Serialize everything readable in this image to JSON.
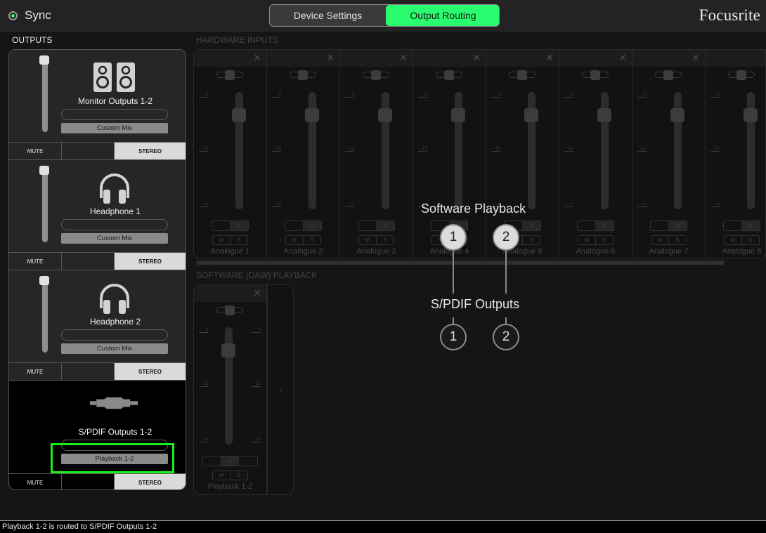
{
  "header": {
    "sync_label": "Sync",
    "sync_status_color": "#2ff06a",
    "tabs": [
      {
        "label": "Device Settings",
        "active": false
      },
      {
        "label": "Output Routing",
        "active": true
      }
    ],
    "active_tab_color": "#29fd6f",
    "brand": "Focusrite"
  },
  "outputs": {
    "section_label": "OUTPUTS",
    "cards": [
      {
        "name": "Monitor Outputs 1-2",
        "icon": "speakers-icon",
        "source": "Custom Mix",
        "mute_label": "MUTE",
        "stereo_label": "STEREO",
        "selected": false
      },
      {
        "name": "Headphone 1",
        "icon": "headphones-icon",
        "source": "Custom Mix",
        "mute_label": "MUTE",
        "stereo_label": "STEREO",
        "selected": false
      },
      {
        "name": "Headphone 2",
        "icon": "headphones-icon",
        "source": "Custom Mix",
        "mute_label": "MUTE",
        "stereo_label": "STEREO",
        "selected": false
      },
      {
        "name": "S/PDIF Outputs 1-2",
        "icon": "spdif-connector-icon",
        "source": "Playback 1-2",
        "mute_label": "MUTE",
        "stereo_label": "STEREO",
        "selected": true
      }
    ],
    "highlight_color": "#1bf01b"
  },
  "hardware_inputs": {
    "section_label": "HARDWARE INPUTS",
    "scale_labels": [
      "0",
      "-12",
      "-∞"
    ],
    "close_glyph": "✕",
    "channels": [
      {
        "name": "Analogue 1",
        "gain": "0",
        "mute": "M",
        "solo": "S"
      },
      {
        "name": "Analogue 2",
        "gain": "0",
        "mute": "M",
        "solo": "S"
      },
      {
        "name": "Analogue 3",
        "gain": "0",
        "mute": "M",
        "solo": "S"
      },
      {
        "name": "Analogue 4",
        "gain": "0",
        "mute": "M",
        "solo": "S"
      },
      {
        "name": "Analogue 5",
        "gain": "0",
        "mute": "M",
        "solo": "S"
      },
      {
        "name": "Analogue 6",
        "gain": "0",
        "mute": "M",
        "solo": "S"
      },
      {
        "name": "Analogue 7",
        "gain": "0",
        "mute": "M",
        "solo": "S"
      },
      {
        "name": "Analogue 8",
        "gain": "0",
        "mute": "M",
        "solo": "S"
      }
    ]
  },
  "software_playback": {
    "section_label": "SOFTWARE (DAW) PLAYBACK",
    "channels": [
      {
        "name": "Playback 1-2",
        "gain": "0",
        "mute": "M",
        "solo": "S"
      }
    ],
    "add_glyph": "+"
  },
  "routing_overlay": {
    "source_title": "Software Playback",
    "dest_title": "S/PDIF Outputs",
    "sources": [
      "1",
      "2"
    ],
    "destinations": [
      "1",
      "2"
    ]
  },
  "status_bar": {
    "text": "Playback 1-2 is routed to S/PDIF Outputs 1-2"
  }
}
